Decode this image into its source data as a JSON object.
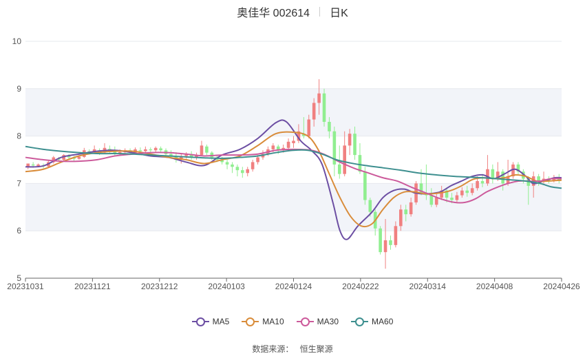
{
  "title": {
    "name": "奥佳华 002614",
    "period": "日K"
  },
  "source": {
    "label": "数据来源：",
    "value": "恒生聚源"
  },
  "colors": {
    "up": "#f08080",
    "down": "#90ee90",
    "grid": "#e6e8ee",
    "band": "#f2f4f9",
    "axis": "#666666"
  },
  "chart_data": {
    "type": "candlestick",
    "ylim": [
      5,
      10
    ],
    "yticks": [
      5,
      6,
      7,
      8,
      9,
      10
    ],
    "xticks": [
      "20231031",
      "20231121",
      "20231212",
      "20240103",
      "20240124",
      "20240222",
      "20240314",
      "20240408",
      "20240426"
    ],
    "legend_position": "bottom",
    "series": [
      {
        "name": "MA5",
        "color": "#6c4ea3",
        "values": [
          [
            0,
            7.35
          ],
          [
            5,
            7.37
          ],
          [
            10,
            7.55
          ],
          [
            15,
            7.62
          ],
          [
            20,
            7.68
          ],
          [
            25,
            7.7
          ],
          [
            30,
            7.65
          ],
          [
            35,
            7.58
          ],
          [
            40,
            7.55
          ],
          [
            45,
            7.45
          ],
          [
            50,
            7.38
          ],
          [
            55,
            7.6
          ],
          [
            60,
            7.72
          ],
          [
            65,
            7.95
          ],
          [
            70,
            8.28
          ],
          [
            73,
            8.3
          ],
          [
            77,
            7.9
          ],
          [
            80,
            7.7
          ],
          [
            83,
            7.4
          ],
          [
            86,
            6.6
          ],
          [
            88,
            6.0
          ],
          [
            90,
            5.82
          ],
          [
            93,
            6.1
          ],
          [
            97,
            6.4
          ],
          [
            100,
            6.7
          ],
          [
            103,
            6.85
          ],
          [
            106,
            6.88
          ],
          [
            109,
            6.8
          ],
          [
            112,
            6.78
          ],
          [
            116,
            6.82
          ],
          [
            119,
            6.95
          ],
          [
            122,
            7.05
          ],
          [
            125,
            7.15
          ],
          [
            128,
            7.18
          ],
          [
            131,
            7.1
          ],
          [
            134,
            7.2
          ],
          [
            137,
            7.3
          ],
          [
            140,
            7.15
          ],
          [
            142,
            7.0
          ],
          [
            145,
            7.05
          ],
          [
            148,
            7.12
          ],
          [
            150,
            7.12
          ]
        ]
      },
      {
        "name": "MA10",
        "color": "#d98c3a",
        "values": [
          [
            0,
            7.25
          ],
          [
            5,
            7.3
          ],
          [
            10,
            7.45
          ],
          [
            15,
            7.58
          ],
          [
            20,
            7.65
          ],
          [
            25,
            7.68
          ],
          [
            30,
            7.68
          ],
          [
            35,
            7.62
          ],
          [
            40,
            7.55
          ],
          [
            45,
            7.5
          ],
          [
            50,
            7.42
          ],
          [
            55,
            7.5
          ],
          [
            60,
            7.58
          ],
          [
            65,
            7.8
          ],
          [
            70,
            8.05
          ],
          [
            75,
            8.08
          ],
          [
            79,
            8.0
          ],
          [
            82,
            7.7
          ],
          [
            85,
            7.2
          ],
          [
            88,
            6.7
          ],
          [
            91,
            6.3
          ],
          [
            94,
            6.1
          ],
          [
            97,
            6.15
          ],
          [
            100,
            6.45
          ],
          [
            103,
            6.7
          ],
          [
            106,
            6.82
          ],
          [
            109,
            6.82
          ],
          [
            112,
            6.78
          ],
          [
            116,
            6.8
          ],
          [
            119,
            6.85
          ],
          [
            122,
            6.95
          ],
          [
            125,
            7.08
          ],
          [
            128,
            7.12
          ],
          [
            131,
            7.1
          ],
          [
            134,
            7.12
          ],
          [
            137,
            7.18
          ],
          [
            140,
            7.15
          ],
          [
            143,
            7.05
          ],
          [
            146,
            7.05
          ],
          [
            150,
            7.07
          ]
        ]
      },
      {
        "name": "MA30",
        "color": "#cc5a9b",
        "values": [
          [
            0,
            7.55
          ],
          [
            5,
            7.5
          ],
          [
            10,
            7.47
          ],
          [
            15,
            7.47
          ],
          [
            20,
            7.5
          ],
          [
            25,
            7.58
          ],
          [
            30,
            7.62
          ],
          [
            35,
            7.65
          ],
          [
            40,
            7.65
          ],
          [
            45,
            7.62
          ],
          [
            50,
            7.58
          ],
          [
            55,
            7.6
          ],
          [
            60,
            7.6
          ],
          [
            65,
            7.62
          ],
          [
            70,
            7.7
          ],
          [
            75,
            7.72
          ],
          [
            80,
            7.7
          ],
          [
            84,
            7.6
          ],
          [
            88,
            7.45
          ],
          [
            92,
            7.32
          ],
          [
            96,
            7.22
          ],
          [
            100,
            7.12
          ],
          [
            104,
            7.05
          ],
          [
            108,
            6.92
          ],
          [
            112,
            6.8
          ],
          [
            116,
            6.68
          ],
          [
            120,
            6.6
          ],
          [
            123,
            6.6
          ],
          [
            126,
            6.68
          ],
          [
            129,
            6.82
          ],
          [
            132,
            6.92
          ],
          [
            135,
            7.0
          ],
          [
            138,
            7.05
          ],
          [
            141,
            7.05
          ],
          [
            144,
            7.05
          ],
          [
            147,
            7.1
          ],
          [
            150,
            7.1
          ]
        ]
      },
      {
        "name": "MA60",
        "color": "#3d8f8f",
        "values": [
          [
            0,
            7.78
          ],
          [
            5,
            7.72
          ],
          [
            10,
            7.68
          ],
          [
            15,
            7.65
          ],
          [
            20,
            7.63
          ],
          [
            25,
            7.63
          ],
          [
            30,
            7.62
          ],
          [
            35,
            7.6
          ],
          [
            40,
            7.58
          ],
          [
            45,
            7.56
          ],
          [
            50,
            7.54
          ],
          [
            55,
            7.53
          ],
          [
            60,
            7.55
          ],
          [
            65,
            7.58
          ],
          [
            70,
            7.65
          ],
          [
            75,
            7.7
          ],
          [
            79,
            7.7
          ],
          [
            83,
            7.62
          ],
          [
            87,
            7.5
          ],
          [
            91,
            7.43
          ],
          [
            95,
            7.38
          ],
          [
            100,
            7.33
          ],
          [
            105,
            7.28
          ],
          [
            110,
            7.22
          ],
          [
            115,
            7.18
          ],
          [
            120,
            7.15
          ],
          [
            125,
            7.13
          ],
          [
            130,
            7.11
          ],
          [
            135,
            7.08
          ],
          [
            140,
            7.05
          ],
          [
            144,
            7.0
          ],
          [
            147,
            6.93
          ],
          [
            150,
            6.9
          ]
        ]
      }
    ],
    "candles": [
      [
        7.35,
        7.42,
        7.4,
        7.3
      ],
      [
        7.4,
        7.38,
        7.45,
        7.33
      ],
      [
        7.37,
        7.4,
        7.42,
        7.34
      ],
      [
        7.38,
        7.36,
        7.42,
        7.32
      ],
      [
        7.36,
        7.45,
        7.48,
        7.33
      ],
      [
        7.45,
        7.55,
        7.58,
        7.42
      ],
      [
        7.52,
        7.5,
        7.56,
        7.46
      ],
      [
        7.5,
        7.6,
        7.62,
        7.48
      ],
      [
        7.58,
        7.55,
        7.62,
        7.52
      ],
      [
        7.55,
        7.52,
        7.58,
        7.48
      ],
      [
        7.52,
        7.56,
        7.6,
        7.5
      ],
      [
        7.56,
        7.7,
        7.75,
        7.54
      ],
      [
        7.68,
        7.66,
        7.72,
        7.62
      ],
      [
        7.66,
        7.72,
        7.8,
        7.64
      ],
      [
        7.7,
        7.65,
        7.74,
        7.6
      ],
      [
        7.65,
        7.75,
        7.85,
        7.62
      ],
      [
        7.73,
        7.68,
        7.8,
        7.64
      ],
      [
        7.68,
        7.62,
        7.78,
        7.58
      ],
      [
        7.62,
        7.66,
        7.72,
        7.58
      ],
      [
        7.66,
        7.7,
        7.74,
        7.62
      ],
      [
        7.7,
        7.65,
        7.74,
        7.6
      ],
      [
        7.65,
        7.72,
        7.76,
        7.62
      ],
      [
        7.7,
        7.68,
        7.76,
        7.64
      ],
      [
        7.68,
        7.72,
        7.78,
        7.65
      ],
      [
        7.72,
        7.7,
        7.76,
        7.66
      ],
      [
        7.7,
        7.75,
        7.78,
        7.66
      ],
      [
        7.74,
        7.7,
        7.78,
        7.65
      ],
      [
        7.7,
        7.62,
        7.74,
        7.58
      ],
      [
        7.62,
        7.58,
        7.7,
        7.52
      ],
      [
        7.58,
        7.5,
        7.66,
        7.44
      ],
      [
        7.5,
        7.58,
        7.62,
        7.42
      ],
      [
        7.58,
        7.62,
        7.66,
        7.52
      ],
      [
        7.62,
        7.55,
        7.68,
        7.5
      ],
      [
        7.55,
        7.6,
        7.65,
        7.5
      ],
      [
        7.6,
        7.8,
        7.9,
        7.58
      ],
      [
        7.78,
        7.65,
        7.82,
        7.6
      ],
      [
        7.65,
        7.55,
        7.68,
        7.5
      ],
      [
        7.55,
        7.5,
        7.6,
        7.45
      ],
      [
        7.5,
        7.45,
        7.56,
        7.4
      ],
      [
        7.45,
        7.4,
        7.5,
        7.3
      ],
      [
        7.4,
        7.35,
        7.45,
        7.22
      ],
      [
        7.35,
        7.28,
        7.4,
        7.15
      ],
      [
        7.28,
        7.22,
        7.35,
        7.12
      ],
      [
        7.22,
        7.3,
        7.35,
        7.15
      ],
      [
        7.3,
        7.45,
        7.5,
        7.25
      ],
      [
        7.45,
        7.55,
        7.6,
        7.4
      ],
      [
        7.55,
        7.62,
        7.7,
        7.5
      ],
      [
        7.62,
        7.72,
        7.78,
        7.58
      ],
      [
        7.72,
        7.8,
        7.85,
        7.66
      ],
      [
        7.78,
        7.7,
        7.82,
        7.62
      ],
      [
        7.7,
        7.75,
        7.82,
        7.65
      ],
      [
        7.75,
        7.88,
        7.95,
        7.7
      ],
      [
        7.85,
        7.9,
        8.0,
        7.75
      ],
      [
        7.9,
        8.1,
        8.25,
        7.85
      ],
      [
        8.05,
        8.0,
        8.4,
        7.95
      ],
      [
        8.0,
        8.35,
        8.45,
        7.95
      ],
      [
        8.35,
        8.7,
        8.8,
        8.2
      ],
      [
        8.7,
        8.9,
        9.2,
        8.45
      ],
      [
        8.9,
        8.3,
        9.0,
        8.2
      ],
      [
        8.3,
        8.1,
        8.4,
        7.95
      ],
      [
        8.1,
        7.4,
        8.2,
        7.15
      ],
      [
        7.4,
        7.2,
        7.8,
        7.1
      ],
      [
        7.2,
        7.8,
        8.1,
        7.15
      ],
      [
        7.8,
        8.05,
        8.15,
        7.6
      ],
      [
        8.05,
        7.6,
        8.2,
        7.5
      ],
      [
        7.6,
        7.25,
        7.85,
        7.2
      ],
      [
        7.25,
        6.65,
        7.35,
        6.55
      ],
      [
        6.65,
        6.4,
        6.7,
        6.3
      ],
      [
        6.4,
        6.05,
        6.45,
        5.9
      ],
      [
        6.05,
        5.55,
        6.1,
        5.5
      ],
      [
        5.55,
        5.8,
        6.25,
        5.2
      ],
      [
        5.8,
        5.7,
        5.9,
        5.6
      ],
      [
        5.7,
        6.1,
        6.2,
        5.65
      ],
      [
        6.1,
        6.45,
        6.55,
        6.0
      ],
      [
        6.45,
        6.35,
        6.55,
        6.2
      ],
      [
        6.35,
        6.6,
        6.7,
        6.3
      ],
      [
        6.6,
        7.0,
        7.05,
        6.55
      ],
      [
        7.0,
        6.8,
        7.3,
        6.75
      ],
      [
        6.8,
        6.75,
        7.4,
        6.65
      ],
      [
        6.75,
        6.55,
        6.9,
        6.5
      ],
      [
        6.55,
        6.7,
        6.8,
        6.5
      ],
      [
        6.7,
        6.85,
        6.95,
        6.65
      ],
      [
        6.85,
        6.7,
        6.9,
        6.6
      ],
      [
        6.7,
        6.65,
        6.8,
        6.58
      ],
      [
        6.65,
        6.75,
        6.82,
        6.6
      ],
      [
        6.75,
        6.85,
        6.92,
        6.7
      ],
      [
        6.85,
        6.8,
        6.95,
        6.72
      ],
      [
        6.8,
        6.9,
        7.0,
        6.75
      ],
      [
        6.9,
        7.05,
        7.15,
        6.85
      ],
      [
        7.05,
        7.0,
        7.2,
        6.92
      ],
      [
        7.0,
        7.3,
        7.6,
        6.95
      ],
      [
        7.3,
        7.1,
        7.4,
        7.0
      ],
      [
        7.1,
        7.25,
        7.45,
        7.05
      ],
      [
        7.25,
        7.0,
        7.3,
        6.85
      ],
      [
        7.0,
        7.15,
        7.5,
        6.95
      ],
      [
        7.15,
        7.4,
        7.45,
        7.1
      ],
      [
        7.4,
        7.25,
        7.45,
        7.18
      ],
      [
        7.25,
        7.1,
        7.3,
        7.0
      ],
      [
        7.1,
        6.95,
        7.15,
        6.55
      ],
      [
        6.95,
        7.15,
        7.25,
        6.7
      ],
      [
        7.15,
        7.05,
        7.2,
        6.95
      ],
      [
        7.05,
        7.1,
        7.25,
        7.0
      ],
      [
        7.1,
        7.05,
        7.15,
        7.0
      ],
      [
        7.05,
        7.12,
        7.18,
        7.02
      ],
      [
        7.12,
        7.05,
        7.2,
        7.0
      ]
    ]
  }
}
